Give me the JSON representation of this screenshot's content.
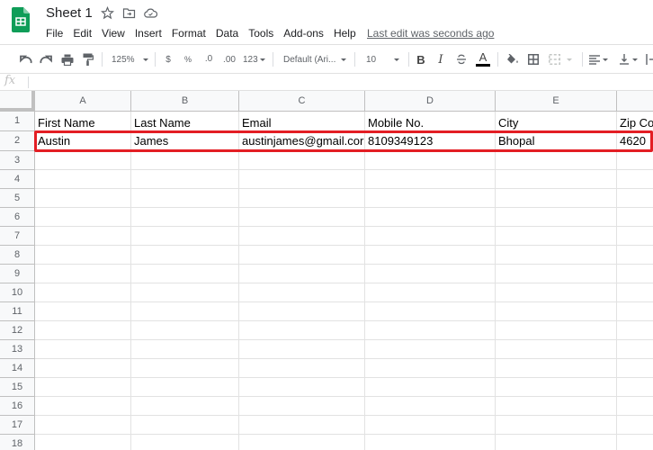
{
  "app": {
    "document_title": "Sheet 1",
    "title_icons": [
      "star-icon",
      "move-to-folder-icon",
      "cloud-saved-icon"
    ],
    "brand_color": "#0f9d58"
  },
  "menu": {
    "items": [
      "File",
      "Edit",
      "View",
      "Insert",
      "Format",
      "Data",
      "Tools",
      "Add-ons",
      "Help"
    ],
    "last_edit": "Last edit was seconds ago"
  },
  "toolbar": {
    "zoom": "125%",
    "currency": "$",
    "percent": "%",
    "decrease_decimal": ".0",
    "increase_decimal": ".00",
    "more_formats": "123",
    "font": "Default (Ari...",
    "font_size": "10",
    "text_color": "#000000"
  },
  "formula_bar": {
    "fx_label": "fx",
    "value": ""
  },
  "sheet": {
    "columns": [
      "A",
      "B",
      "C",
      "D",
      "E",
      "F"
    ],
    "row_numbers": [
      "1",
      "2",
      "3",
      "4",
      "5",
      "6",
      "7",
      "8",
      "9",
      "10",
      "11",
      "12",
      "13",
      "14",
      "15",
      "16",
      "17",
      "18"
    ],
    "rows": [
      [
        "First Name",
        "Last Name",
        "Email",
        "Mobile No.",
        "City",
        "Zip Co"
      ],
      [
        "Austin",
        "James",
        "austinjames@gmail.cor",
        "8109349123",
        "Bhopal",
        "4620"
      ]
    ],
    "highlighted_row": "2",
    "highlight_color": "#e31e24"
  }
}
